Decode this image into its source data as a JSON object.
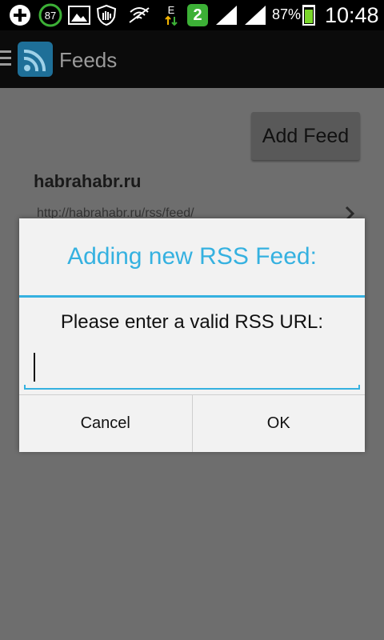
{
  "status_bar": {
    "notification_count": "87",
    "sim_badge": "2",
    "network_type": "E",
    "battery_percent": "87%",
    "time": "10:48",
    "icons": [
      "add-icon",
      "notification-count-icon",
      "gallery-icon",
      "hand-shield-icon",
      "signal-muted-icon",
      "data-arrows-icon",
      "sim-icon",
      "wifi-signal-icon",
      "cell-signal-icon",
      "battery-icon"
    ]
  },
  "action_bar": {
    "title": "Feeds",
    "icons": [
      "menu-icon",
      "rss-icon"
    ]
  },
  "main": {
    "add_feed_label": "Add Feed",
    "feeds": [
      {
        "title": "habrahabr.ru",
        "url": "http://habrahabr.ru/rss/feed/"
      }
    ]
  },
  "dialog": {
    "title": "Adding new RSS Feed:",
    "message": "Please enter a valid RSS URL:",
    "input_value": "",
    "cancel_label": "Cancel",
    "ok_label": "OK"
  },
  "colors": {
    "accent": "#35b1e0",
    "battery": "#7ad62a",
    "sim_badge": "#3cb036",
    "overlay_bg": "#6e6e6e"
  }
}
